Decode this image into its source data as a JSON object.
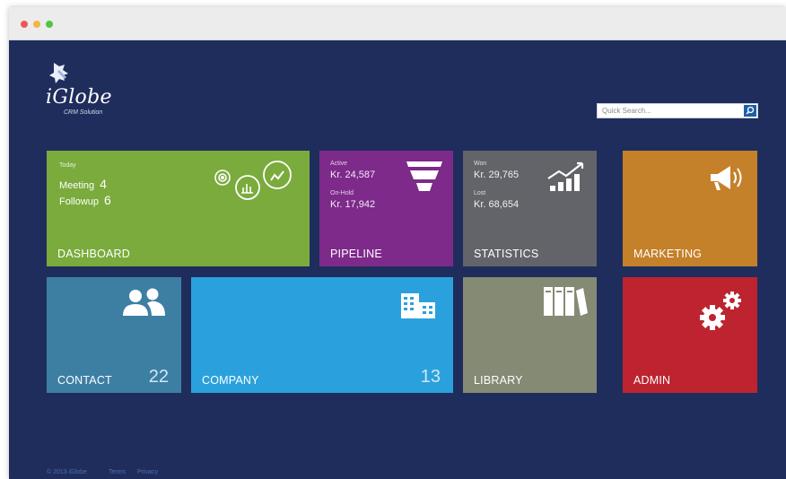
{
  "window": {
    "controls": [
      "close",
      "minimize",
      "maximize"
    ]
  },
  "brand": {
    "name": "iGlobe",
    "tagline": "CRM Solution"
  },
  "search": {
    "placeholder": "Quick Search...",
    "icon": "search-icon"
  },
  "tiles": {
    "dashboard": {
      "title": "DASHBOARD",
      "color": "#7aab3c",
      "today_label": "Today",
      "meeting_label": "Meeting",
      "meeting_count": "4",
      "followup_label": "Followup",
      "followup_count": "6",
      "icons": [
        "target-icon",
        "bar-chart-circle-icon",
        "line-chart-circle-icon"
      ]
    },
    "pipeline": {
      "title": "PIPELINE",
      "color": "#7d2a8a",
      "active_label": "Active",
      "active_value": "Kr. 24,587",
      "onhold_label": "On-Hold",
      "onhold_value": "Kr. 17,942",
      "icon": "funnel-icon"
    },
    "statistics": {
      "title": "STATISTICS",
      "color": "#636469",
      "won_label": "Won",
      "won_value": "Kr. 29,765",
      "lost_label": "Lost",
      "lost_value": "Kr. 68,654",
      "icon": "trend-chart-icon"
    },
    "marketing": {
      "title": "MARKETING",
      "color": "#c5802a",
      "icon": "megaphone-icon"
    },
    "contact": {
      "title": "CONTACT",
      "count": "22",
      "color": "#3d7fa3",
      "icon": "users-icon"
    },
    "company": {
      "title": "COMPANY",
      "count": "13",
      "color": "#2aa1dd",
      "icon": "building-icon"
    },
    "library": {
      "title": "LIBRARY",
      "color": "#858a74",
      "icon": "books-icon"
    },
    "admin": {
      "title": "ADMIN",
      "color": "#bd2430",
      "icon": "gears-icon"
    }
  },
  "footer": {
    "copyright": "© 2013 iGlobe",
    "terms": "Terms",
    "privacy": "Privacy"
  }
}
